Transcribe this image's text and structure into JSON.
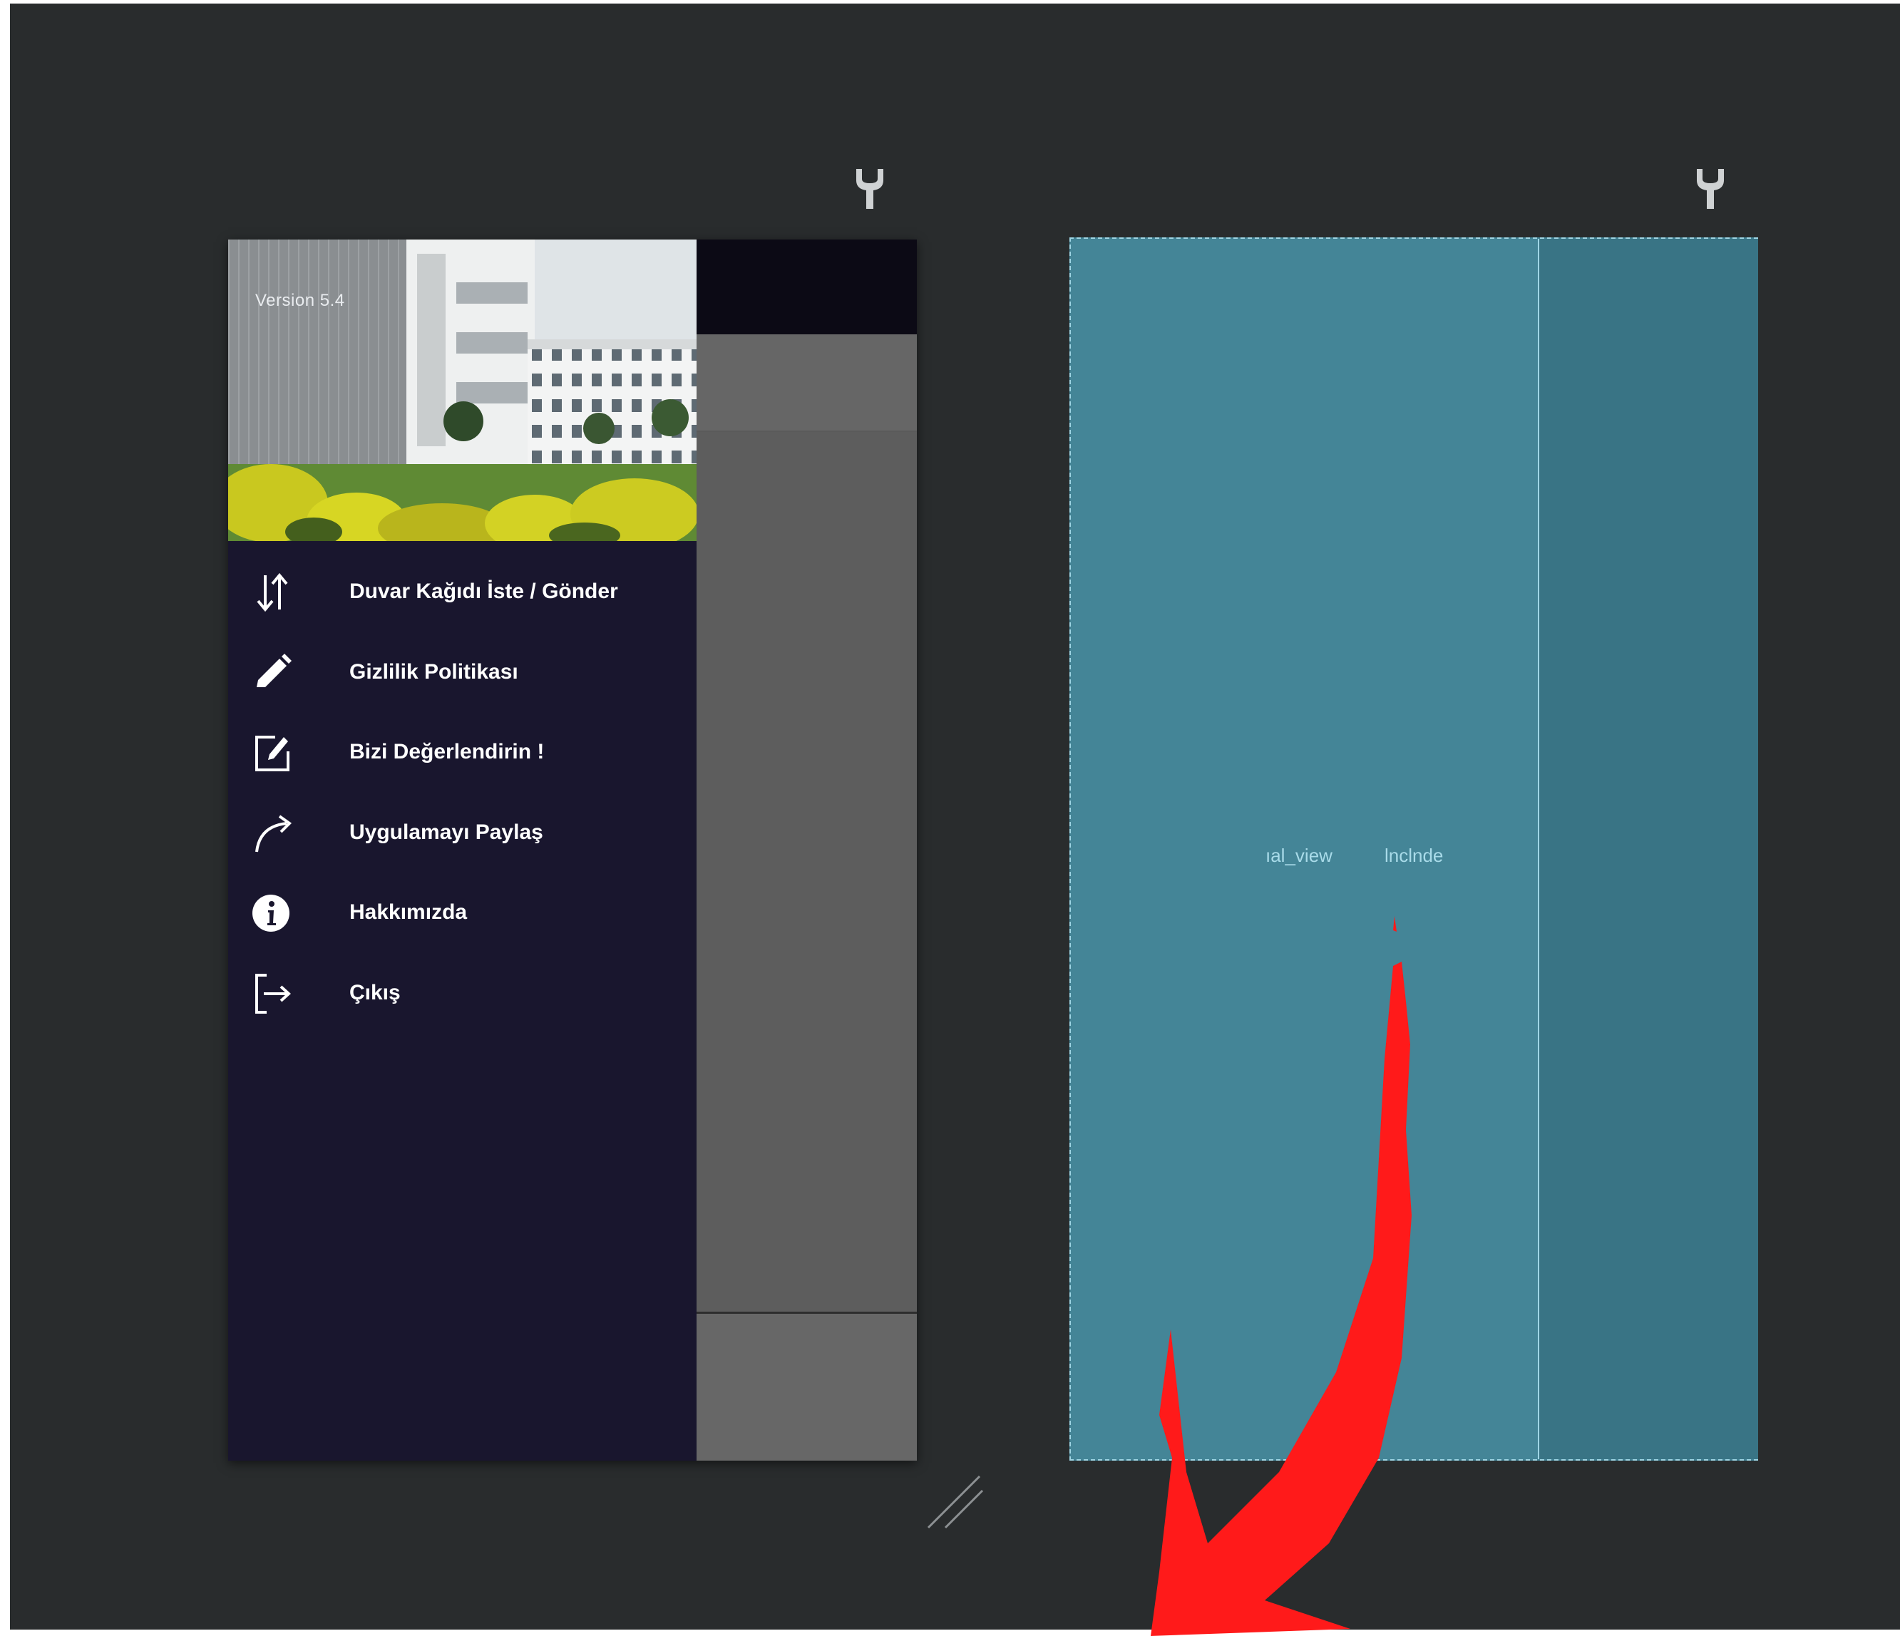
{
  "drawer": {
    "version_text": "Version 5.4",
    "items": [
      {
        "icon": "swap-vertical-icon",
        "label": "Duvar Kağıdı İste / Gönder"
      },
      {
        "icon": "pencil-icon",
        "label": "Gizlilik Politikası"
      },
      {
        "icon": "edit-square-icon",
        "label": "Bizi Değerlendirin !"
      },
      {
        "icon": "share-arrow-icon",
        "label": "Uygulamayı Paylaş"
      },
      {
        "icon": "info-icon",
        "label": "Hakkımızda"
      },
      {
        "icon": "logout-icon",
        "label": "Çıkış"
      }
    ]
  },
  "blueprint": {
    "left_label": "ıal_view",
    "right_label": "lnclnde"
  },
  "colors": {
    "canvas": "#292c2d",
    "drawer": "#19162e",
    "blueprint": "#448597",
    "blueprint_border": "#9fd6e5",
    "arrow": "#ff1a1a"
  }
}
